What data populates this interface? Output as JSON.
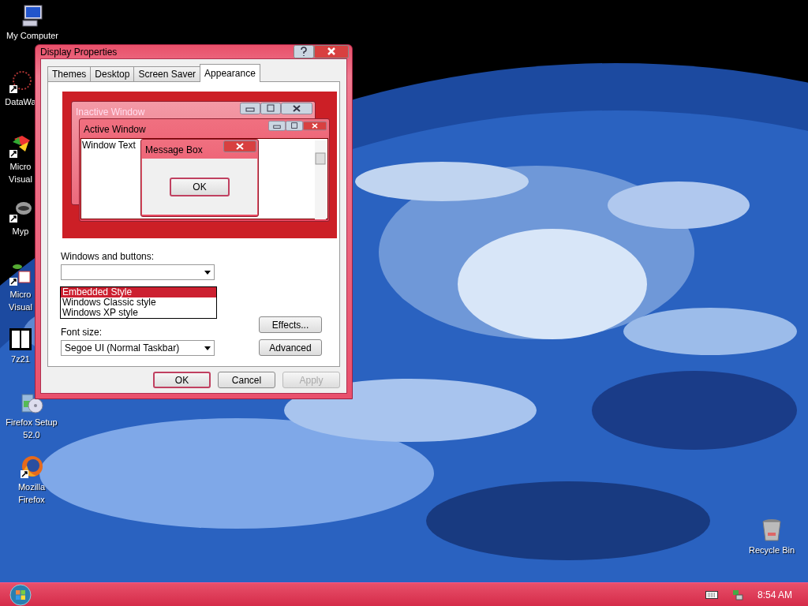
{
  "desktop_icons": [
    {
      "kind": "computer",
      "lines": [
        "My Computer"
      ]
    },
    {
      "kind": "web",
      "lines": [
        "DataWa"
      ]
    },
    {
      "kind": "studio",
      "lines": [
        "Micro",
        "Visual"
      ]
    },
    {
      "kind": "raccoon",
      "lines": [
        "Myp"
      ]
    },
    {
      "kind": "plant",
      "lines": [
        "Micro",
        "Visual"
      ]
    },
    {
      "kind": "zip",
      "lines": [
        "7z21"
      ]
    },
    {
      "kind": "installer",
      "lines": [
        "Firefox Setup",
        "52.0"
      ]
    },
    {
      "kind": "firefox",
      "lines": [
        "Mozilla",
        "Firefox"
      ]
    },
    {
      "kind": "bin",
      "lines": [
        "Recycle Bin"
      ]
    }
  ],
  "dialog": {
    "title": "Display Properties",
    "tabs": [
      {
        "label": "Themes",
        "selected": false
      },
      {
        "label": "Desktop",
        "selected": false
      },
      {
        "label": "Screen Saver",
        "selected": false
      },
      {
        "label": "Appearance",
        "selected": true
      }
    ],
    "preview": {
      "inactive_title": "Inactive Window",
      "active_title": "Active Window",
      "window_text": "Window Text",
      "message_box_title": "Message Box",
      "message_box_button": "OK"
    },
    "windows_and_buttons": {
      "label": "Windows and buttons:",
      "options": [
        {
          "label": "Embedded Style",
          "selected": true
        },
        {
          "label": "Windows Classic style",
          "selected": false
        },
        {
          "label": "Windows XP style",
          "selected": false
        }
      ]
    },
    "font_size": {
      "label": "Font size:",
      "value": "Segoe UI (Normal Taskbar)"
    },
    "side_buttons": [
      "Effects...",
      "Advanced"
    ],
    "footer_buttons": [
      {
        "label": "OK",
        "default": true,
        "disabled": false
      },
      {
        "label": "Cancel",
        "default": false,
        "disabled": false
      },
      {
        "label": "Apply",
        "default": false,
        "disabled": true
      }
    ]
  },
  "taskbar": {
    "clock": "8:54 AM"
  }
}
